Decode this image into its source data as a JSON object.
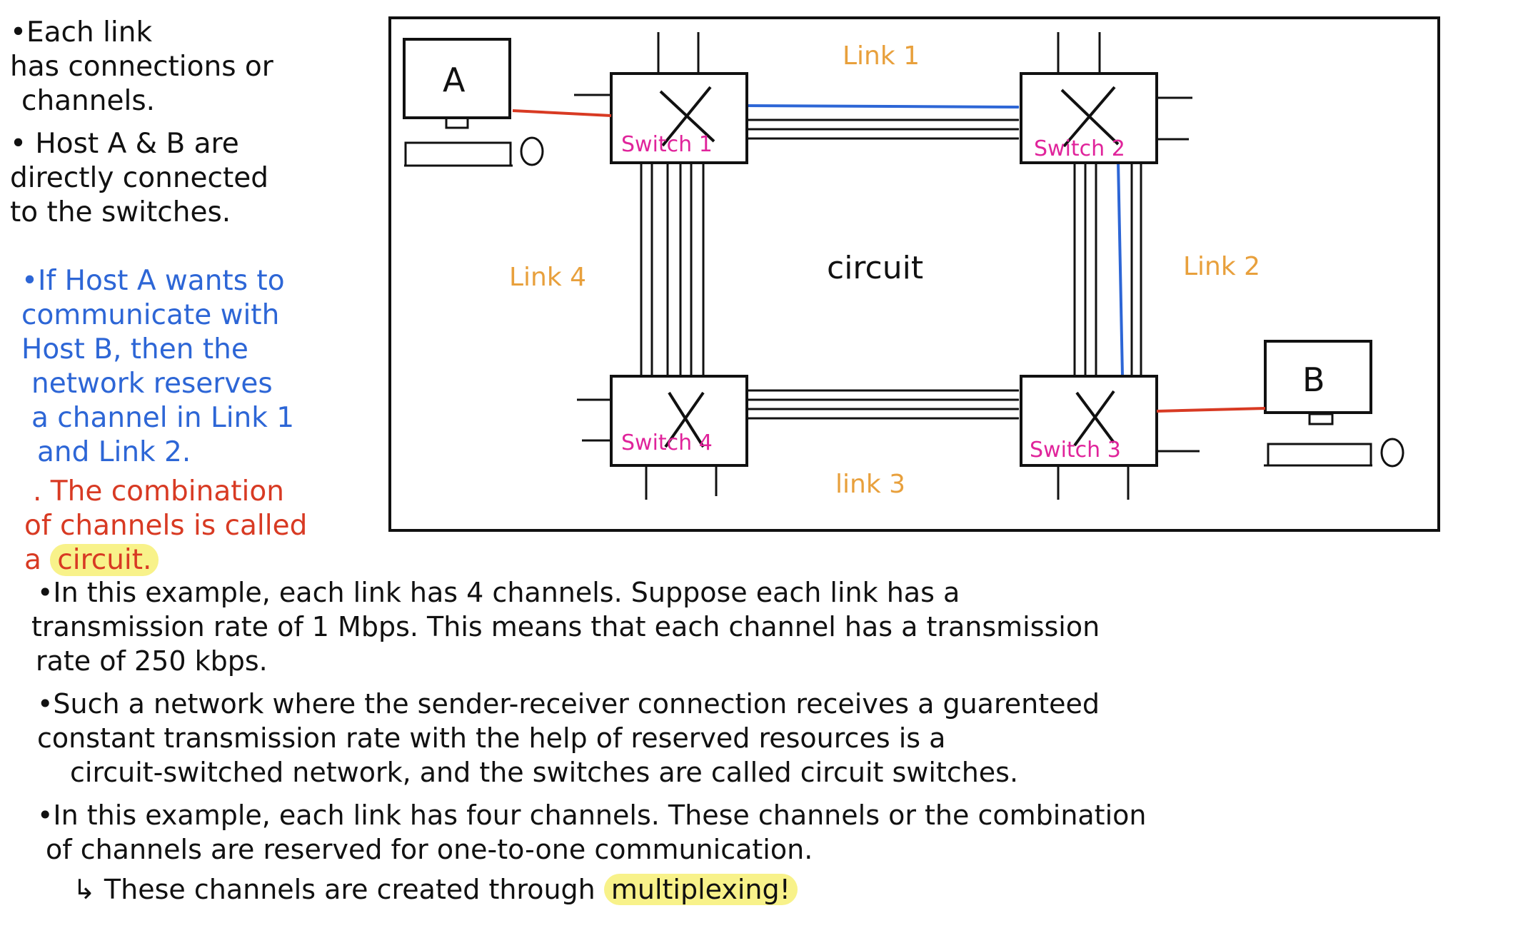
{
  "colors": {
    "black": "#111111",
    "blue": "#2d66d6",
    "red": "#d83a23",
    "orange": "#e8a03c",
    "magenta": "#e0249b",
    "highlight": "#f8f28a"
  },
  "left_notes": {
    "black": [
      "•Each link",
      "has connections or",
      "channels.",
      "• Host A & B are",
      "directly connected",
      "to the switches."
    ],
    "blue": [
      "•If Host A wants to",
      "communicate with",
      "Host B, then the",
      "network reserves",
      "a channel in Link 1",
      "and Link 2."
    ],
    "red": {
      "lines": [
        ". The combination",
        "of channels is called"
      ],
      "last_prefix": "a ",
      "highlighted": "circuit."
    }
  },
  "diagram": {
    "hosts": {
      "a": "A",
      "b": "B"
    },
    "switches": [
      "Switch 1",
      "Switch 2",
      "Switch 3",
      "Switch 4"
    ],
    "links": [
      "Link 1",
      "Link 2",
      "link 3",
      "Link 4"
    ],
    "center_label": "circuit"
  },
  "bottom_notes": {
    "item1": [
      "•In this example, each link has 4 channels. Suppose each link has a",
      "transmission rate of 1 Mbps. This means that each channel has a transmission",
      "rate of 250 kbps."
    ],
    "item2": [
      "•Such a network where the sender-receiver connection receives a guarenteed",
      "constant transmission rate with the help of reserved resources is a",
      "circuit-switched network, and the switches are called circuit switches."
    ],
    "item3": [
      "•In this example, each link has four channels. These channels or the combination",
      "of channels are reserved for one-to-one communication."
    ],
    "sub_prefix": "↳ These channels are created through ",
    "sub_highlight": "multiplexing!"
  }
}
